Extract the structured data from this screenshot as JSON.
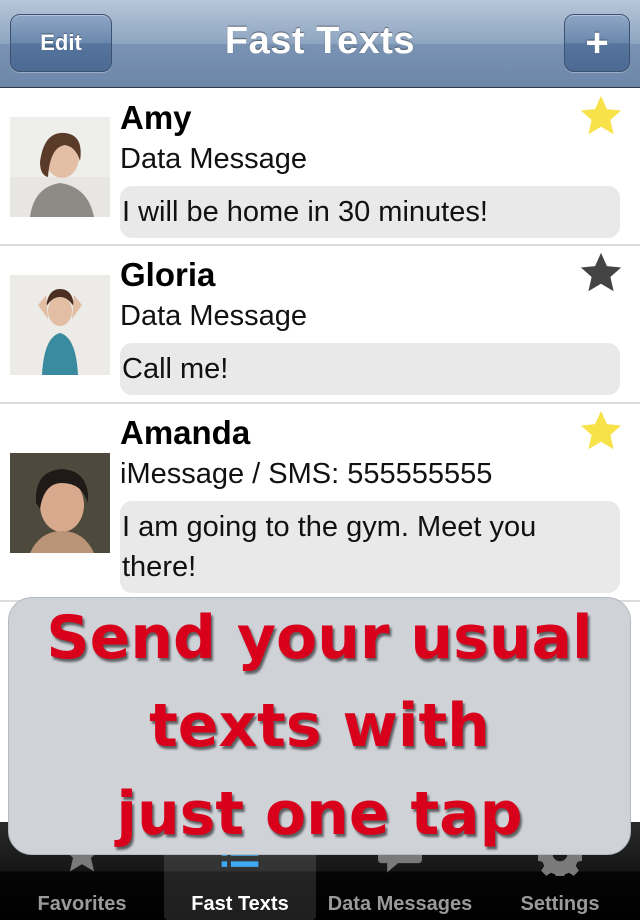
{
  "navbar": {
    "title": "Fast Texts",
    "edit_label": "Edit",
    "add_label": "+"
  },
  "contacts": [
    {
      "name": "Amy",
      "type": "Data Message",
      "message": "I will be home in 30 minutes!",
      "favorite": true
    },
    {
      "name": "Gloria",
      "type": "Data Message",
      "message": "Call me!",
      "favorite": false
    },
    {
      "name": "Amanda",
      "type": "iMessage / SMS: 555555555",
      "message": "I am going to the gym. Meet you there!",
      "favorite": true
    }
  ],
  "promo": {
    "line1": "Send your usual",
    "line2": "texts with",
    "line3": "just one tap"
  },
  "tabs": [
    {
      "label": "Favorites",
      "icon": "star-icon",
      "selected": false
    },
    {
      "label": "Fast Texts",
      "icon": "list-icon",
      "selected": true
    },
    {
      "label": "Data Messages",
      "icon": "speech-bubble-icon",
      "selected": false
    },
    {
      "label": "Settings",
      "icon": "gear-icon",
      "selected": false
    }
  ],
  "colors": {
    "favorite_star": "#f7e24a",
    "unfavorite_star": "#444444",
    "promo_text": "#d8001a"
  }
}
